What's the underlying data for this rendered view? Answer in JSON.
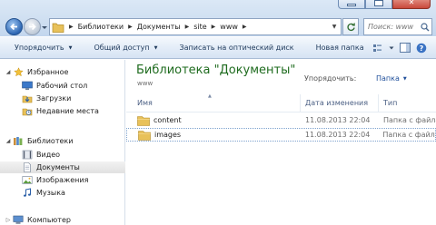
{
  "window": {
    "minimize_icon": "minimize-icon",
    "maximize_icon": "maximize-icon",
    "close_icon": "close-icon"
  },
  "address": {
    "crumbs": [
      "Библиотеки",
      "Документы",
      "site",
      "www"
    ]
  },
  "search": {
    "placeholder": "Поиск: www"
  },
  "toolbar": {
    "organize": "Упорядочить",
    "share": "Общий доступ",
    "burn": "Записать на оптический диск",
    "new_folder": "Новая папка"
  },
  "sidebar": {
    "favorites": "Избранное",
    "favorites_items": [
      "Рабочий стол",
      "Загрузки",
      "Недавние места"
    ],
    "libraries": "Библиотеки",
    "libraries_items": [
      "Видео",
      "Документы",
      "Изображения",
      "Музыка"
    ],
    "computer": "Компьютер"
  },
  "main": {
    "library_title": "Библиотека \"Документы\"",
    "library_subtitle": "www",
    "arrange_label": "Упорядочить:",
    "arrange_value": "Папка",
    "columns": [
      "Имя",
      "Дата изменения",
      "Тип"
    ],
    "rows": [
      {
        "name": "content",
        "date": "11.08.2013 22:04",
        "type": "Папка с файла"
      },
      {
        "name": "images",
        "date": "11.08.2013 22:04",
        "type": "Папка с файла"
      }
    ]
  },
  "colors": {
    "library_title": "#1e6b1e",
    "command_text": "#1e395b",
    "folder": "#e8c15a"
  }
}
